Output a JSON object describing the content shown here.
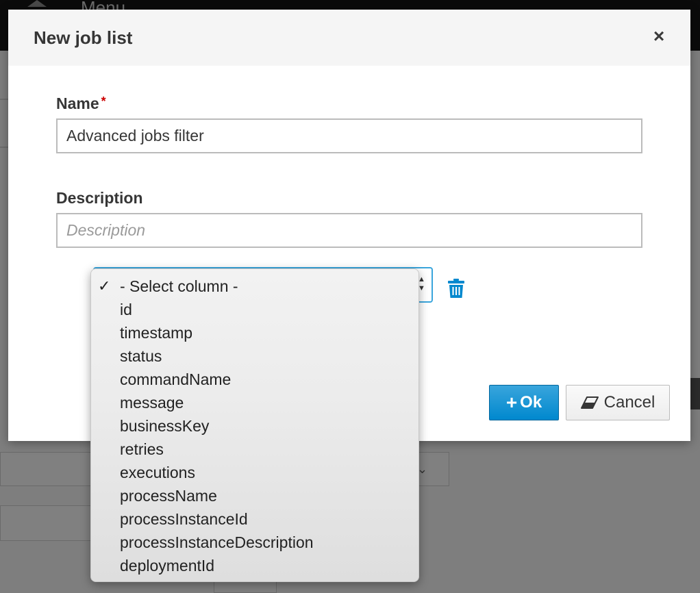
{
  "background": {
    "menu_label": "Menu"
  },
  "modal": {
    "title": "New job list",
    "close_symbol": "×",
    "name_label": "Name",
    "required_marker": "*",
    "name_value": "Advanced jobs filter",
    "description_label": "Description",
    "description_placeholder": "Description",
    "description_value": "",
    "ok_label": "Ok",
    "ok_icon": "plus-icon",
    "cancel_label": "Cancel",
    "cancel_icon": "eraser-icon",
    "delete_icon": "trash-icon"
  },
  "column_select": {
    "selected": "- Select column -",
    "options": [
      "- Select column -",
      "id",
      "timestamp",
      "status",
      "commandName",
      "message",
      "businessKey",
      "retries",
      "executions",
      "processName",
      "processInstanceId",
      "processInstanceDescription",
      "deploymentId"
    ]
  },
  "colors": {
    "primary": "#0088ce",
    "header_bg": "#f5f5f5",
    "required": "#cc0000"
  }
}
